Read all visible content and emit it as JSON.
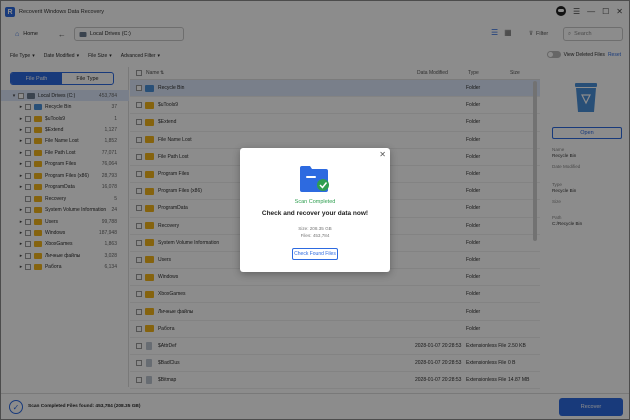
{
  "app": {
    "title": "Recoverit Windows Data Recovery"
  },
  "nav": {
    "home_label": "Home",
    "path_label": "Local Drives (C:)",
    "filter_label": "Filter",
    "search_placeholder": "Search"
  },
  "filterbar": {
    "items": [
      "File Type",
      "Date Modified",
      "File Size",
      "Advanced Filter"
    ],
    "view_deleted_label": "View Deleted Files",
    "reset_label": "Reset"
  },
  "sidebar": {
    "tabs": [
      "File Path",
      "File Type"
    ],
    "tree": [
      {
        "label": "Local Drives (C:)",
        "count": "453,784",
        "icon": "drive-icon",
        "level": 0
      },
      {
        "label": "Recycle Bin",
        "count": "37",
        "icon": "recycle-bin-icon",
        "level": 1
      },
      {
        "label": "$uTools9",
        "count": "1",
        "icon": "folder-icon",
        "level": 1
      },
      {
        "label": "$Extend",
        "count": "1,127",
        "icon": "folder-icon",
        "level": 1
      },
      {
        "label": "File Name Lost",
        "count": "1,852",
        "icon": "folder-icon",
        "level": 1
      },
      {
        "label": "File Path Lost",
        "count": "77,071",
        "icon": "folder-icon",
        "level": 1
      },
      {
        "label": "Program Files",
        "count": "76,064",
        "icon": "folder-icon",
        "level": 1
      },
      {
        "label": "Program Files (x86)",
        "count": "28,793",
        "icon": "folder-icon",
        "level": 1
      },
      {
        "label": "ProgramData",
        "count": "16,078",
        "icon": "folder-icon",
        "level": 1
      },
      {
        "label": "Recovery",
        "count": "5",
        "icon": "folder-icon",
        "level": 1
      },
      {
        "label": "System Volume Information",
        "count": "24",
        "icon": "folder-icon",
        "level": 1
      },
      {
        "label": "Users",
        "count": "99,788",
        "icon": "folder-icon",
        "level": 1
      },
      {
        "label": "Windows",
        "count": "187,948",
        "icon": "folder-icon",
        "level": 1
      },
      {
        "label": "XboxGames",
        "count": "1,863",
        "icon": "folder-icon",
        "level": 1
      },
      {
        "label": "Личные файлы",
        "count": "3,028",
        "icon": "folder-icon",
        "level": 1
      },
      {
        "label": "Работа",
        "count": "6,134",
        "icon": "folder-icon",
        "level": 1
      }
    ]
  },
  "filelist": {
    "headers": {
      "name": "Name",
      "date": "Data Modified",
      "type": "Type",
      "size": "Size"
    },
    "rows": [
      {
        "name": "Recycle Bin",
        "date": "",
        "type": "Folder",
        "size": "",
        "kind": "bin"
      },
      {
        "name": "$uTools9",
        "date": "",
        "type": "Folder",
        "size": "",
        "kind": "folder"
      },
      {
        "name": "$Extend",
        "date": "",
        "type": "Folder",
        "size": "",
        "kind": "folder"
      },
      {
        "name": "File Name Lost",
        "date": "",
        "type": "Folder",
        "size": "",
        "kind": "folder"
      },
      {
        "name": "File Path Lost",
        "date": "",
        "type": "Folder",
        "size": "",
        "kind": "folder"
      },
      {
        "name": "Program Files",
        "date": "",
        "type": "Folder",
        "size": "",
        "kind": "folder"
      },
      {
        "name": "Program Files (x86)",
        "date": "",
        "type": "Folder",
        "size": "",
        "kind": "folder"
      },
      {
        "name": "ProgramData",
        "date": "",
        "type": "Folder",
        "size": "",
        "kind": "folder"
      },
      {
        "name": "Recovery",
        "date": "",
        "type": "Folder",
        "size": "",
        "kind": "folder"
      },
      {
        "name": "System Volume Information",
        "date": "",
        "type": "Folder",
        "size": "",
        "kind": "folder"
      },
      {
        "name": "Users",
        "date": "",
        "type": "Folder",
        "size": "",
        "kind": "folder"
      },
      {
        "name": "Windows",
        "date": "",
        "type": "Folder",
        "size": "",
        "kind": "folder"
      },
      {
        "name": "XboxGames",
        "date": "",
        "type": "Folder",
        "size": "",
        "kind": "folder"
      },
      {
        "name": "Личные файлы",
        "date": "",
        "type": "Folder",
        "size": "",
        "kind": "folder"
      },
      {
        "name": "Работа",
        "date": "",
        "type": "Folder",
        "size": "",
        "kind": "folder"
      },
      {
        "name": "$AttrDef",
        "date": "2028-01-07 20:28:53",
        "type": "Extensionless File",
        "size": "2.50 KB",
        "kind": "file"
      },
      {
        "name": "$BadClus",
        "date": "2028-01-07 20:28:53",
        "type": "Extensionless File",
        "size": "0 B",
        "kind": "file"
      },
      {
        "name": "$Bitmap",
        "date": "2028-01-07 20:28:53",
        "type": "Extensionless File",
        "size": "14.87 MB",
        "kind": "file"
      }
    ]
  },
  "preview": {
    "open_label": "Open",
    "fields": [
      {
        "label": "Name",
        "value": "Recycle Bin"
      },
      {
        "label": "Date Modified",
        "value": ""
      },
      {
        "label": "Type",
        "value": "Recycle Bin"
      },
      {
        "label": "Size",
        "value": ""
      },
      {
        "label": "Path",
        "value": "C:/Recycle Bin"
      }
    ]
  },
  "status": {
    "text": "Scan Completed Files found: 453,784 (208.35 GB)",
    "recover_label": "Recover"
  },
  "modal": {
    "status": "Scan Completed",
    "heading": "Check and recover your data now!",
    "size": "Size: 208.35 GB",
    "files": "Files: 453,784",
    "button_label": "Check Found Files"
  }
}
